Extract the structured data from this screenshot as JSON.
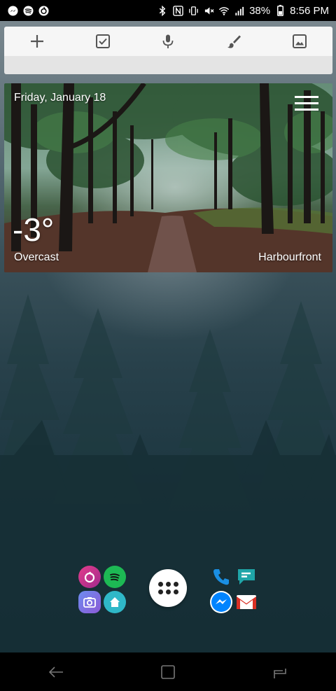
{
  "status_bar": {
    "battery_percent": "38%",
    "time": "8:56 PM",
    "left_icons": [
      "messenger-icon",
      "spotify-icon",
      "firefox-focus-icon"
    ],
    "right_icons": [
      "bluetooth-icon",
      "nfc-icon",
      "vibrate-icon",
      "mute-icon",
      "wifi-icon",
      "signal-icon",
      "battery-icon"
    ]
  },
  "keep_widget": {
    "actions": [
      "add-note",
      "checklist",
      "voice",
      "drawing",
      "image"
    ]
  },
  "weather": {
    "date": "Friday, January 18",
    "temperature": "-3°",
    "condition": "Overcast",
    "location": "Harbourfront"
  },
  "dock": {
    "folder_left": [
      "firefox-focus",
      "spotify",
      "camera",
      "smart-home"
    ],
    "folder_right": [
      "phone",
      "messages",
      "messenger",
      "gmail"
    ],
    "apps_button": "apps-drawer"
  },
  "nav_bar": {
    "buttons": [
      "back",
      "home",
      "recents"
    ]
  },
  "colors": {
    "status_bar": "#000000",
    "nav_bar": "#000000",
    "keep_toolbar": "#f6f6f6",
    "spotify": "#1db954",
    "messenger": "#0084ff",
    "phone": "#1a8fe3",
    "messages": "#1fa5a8",
    "firefox_focus": "#c82f8a"
  }
}
